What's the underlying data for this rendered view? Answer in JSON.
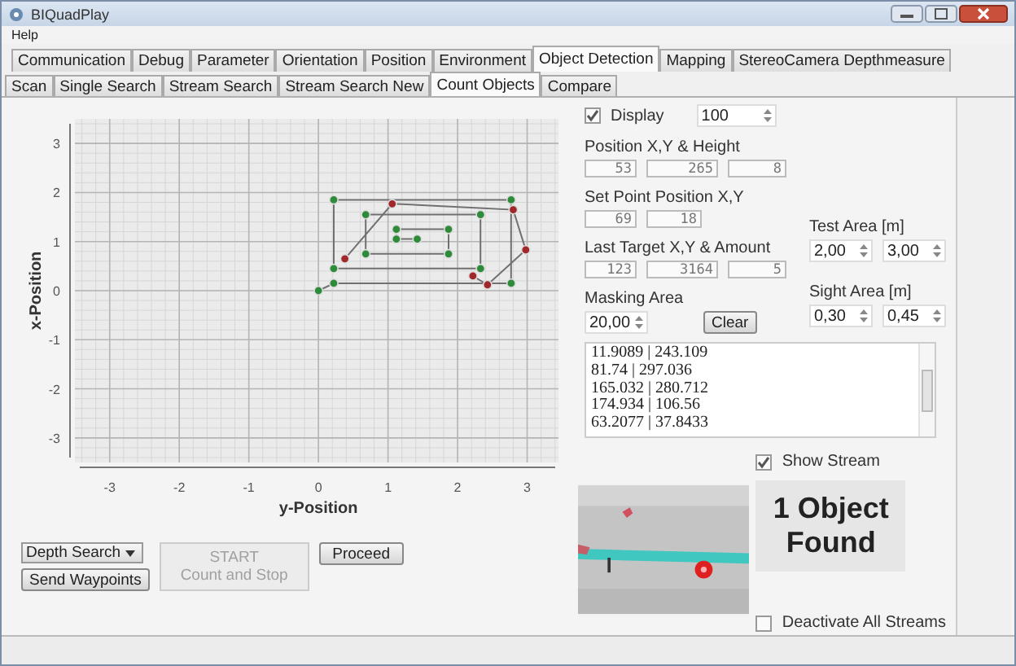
{
  "window": {
    "title": "BIQuadPlay"
  },
  "menu": [
    "Help"
  ],
  "tabs": [
    {
      "label": "Communication",
      "selected": false
    },
    {
      "label": "Debug",
      "selected": false
    },
    {
      "label": "Parameter",
      "selected": false
    },
    {
      "label": "Orientation",
      "selected": false
    },
    {
      "label": "Position",
      "selected": false
    },
    {
      "label": "Environment",
      "selected": false
    },
    {
      "label": "Object Detection",
      "selected": true
    },
    {
      "label": "Mapping",
      "selected": false
    },
    {
      "label": "StereoCamera Depthmeasure",
      "selected": false
    }
  ],
  "subtabs": [
    {
      "label": "Scan",
      "selected": false
    },
    {
      "label": "Single Search",
      "selected": false
    },
    {
      "label": "Stream Search",
      "selected": false
    },
    {
      "label": "Stream Search New",
      "selected": false
    },
    {
      "label": "Count Objects",
      "selected": true
    },
    {
      "label": "Compare",
      "selected": false
    }
  ],
  "plot": {
    "chart_data": {
      "type": "line",
      "grid": true,
      "xlabel": "y-Position",
      "ylabel": "x-Position",
      "xlim": [
        -3.5,
        3.45
      ],
      "ylim": [
        -3.5,
        3.5
      ],
      "xticks": [
        -3,
        -2,
        -1,
        0,
        1,
        2,
        3
      ],
      "yticks": [
        -3,
        -2,
        -1,
        0,
        1,
        2,
        3
      ],
      "series": [
        {
          "color": "#707070",
          "marker": {
            "color": "#2e8b3a"
          },
          "x": [
            0,
            0.22,
            2.77,
            2.77,
            0.22,
            0.22,
            2.33,
            2.33,
            0.68,
            0.68,
            1.87,
            1.87,
            1.12,
            1.12,
            1.42
          ],
          "values": [
            0,
            0.15,
            0.15,
            1.85,
            1.85,
            0.45,
            0.45,
            1.55,
            1.55,
            0.75,
            0.75,
            1.25,
            1.25,
            1.05,
            1.05
          ]
        },
        {
          "color": "#707070",
          "marker": {
            "color": "#a0282a"
          },
          "x": [
            0.38,
            1.06,
            2.8,
            2.98,
            2.43,
            2.22
          ],
          "values": [
            0.65,
            1.77,
            1.65,
            0.83,
            0.12,
            0.3
          ]
        }
      ]
    }
  },
  "controls": {
    "mode_dropdown": "Depth Search",
    "send_button": "Send Waypoints",
    "start_button": {
      "label": "START",
      "sublabel": "Count and Stop",
      "disabled": true
    },
    "proceed_button": "Proceed"
  },
  "display": {
    "label": "Display",
    "checked": true,
    "value": "100"
  },
  "position": {
    "label": "Position X,Y & Height",
    "values": [
      "53",
      "265",
      "8"
    ]
  },
  "set_point": {
    "label": "Set Point Position X,Y",
    "values": [
      "69",
      "18"
    ]
  },
  "last_target": {
    "label": "Last Target X,Y & Amount",
    "values": [
      "123",
      "3164",
      "5"
    ]
  },
  "masking": {
    "label": "Masking Area",
    "value": "20,00",
    "button": "Clear"
  },
  "test_area": {
    "label": "Test Area [m]",
    "values": [
      "2,00",
      "3,00"
    ]
  },
  "sight_area": {
    "label": "Sight Area [m]",
    "values": [
      "0,30",
      "0,45"
    ]
  },
  "coordinates": [
    "11.9089 | 243.109",
    "81.74 | 297.036",
    "165.032 | 280.712",
    "174.934 | 106.56",
    "63.2077 | 37.8433"
  ],
  "stream": {
    "show_label": "Show Stream",
    "show_checked": true,
    "result": "1 Object Found",
    "deactivate_label": "Deactivate All Streams",
    "deactivate_checked": false
  }
}
